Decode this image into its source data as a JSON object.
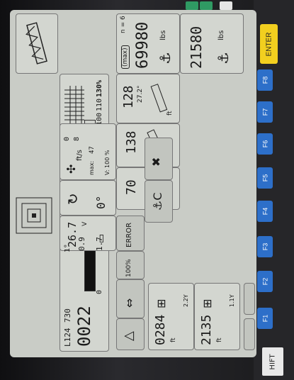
{
  "header": {
    "counter": "n = 6"
  },
  "load": {
    "max_label": "(max)",
    "max_value": "69980",
    "max_unit": "lbs",
    "current_value": "21580",
    "current_unit": "lbs"
  },
  "boom": {
    "length_value": "128",
    "length_unit": "ft",
    "length_angle": "27.2°",
    "radius_value": "138",
    "radius_unit": "ft",
    "height_value": "70",
    "height_unit": "ft"
  },
  "bar": {
    "scale": [
      "90",
      "100",
      "110",
      "130%"
    ],
    "left_marks": [
      "L124",
      "730"
    ],
    "big_value": "0022",
    "zero": "0",
    "mid": "90"
  },
  "wind": {
    "values": [
      "0",
      "8",
      "47"
    ],
    "unit": "ft/s",
    "max_label": "max:",
    "v_label": "V: 100 %"
  },
  "slew": {
    "value": "0°"
  },
  "voltage": {
    "value": "26.7",
    "unit": "V"
  },
  "status": {
    "error_label": "ERROR",
    "percent_label": "100%"
  },
  "level": {
    "value_a": "0.9",
    "value_b": "1.7",
    "deg_label": "1°"
  },
  "bottom": {
    "left_value": "0284",
    "left_unit": "ft",
    "left_tag": "2.2Y",
    "right_value": "2135",
    "right_unit": "ft",
    "right_tag": "1.1Y"
  },
  "fkeys": [
    "F1",
    "F2",
    "F3",
    "F4",
    "F5",
    "F6",
    "F7",
    "F8"
  ],
  "enter_label": "ENTER",
  "shift_label": "HIFT"
}
